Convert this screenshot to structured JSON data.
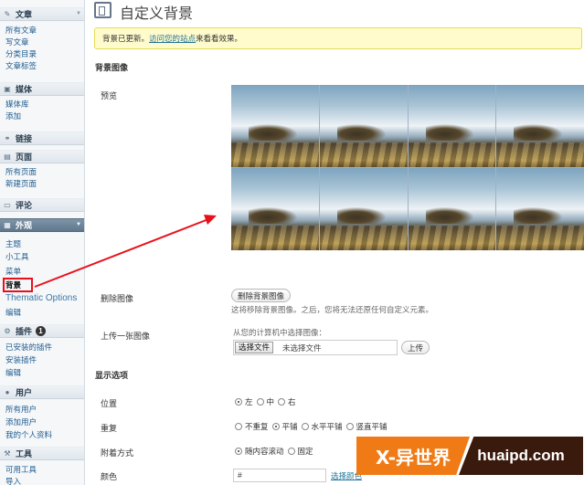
{
  "sidebar": {
    "articles": {
      "label": "文章",
      "items": [
        "所有文章",
        "写文章",
        "分类目录",
        "文章标签"
      ]
    },
    "media": {
      "label": "媒体",
      "items": [
        "媒体库",
        "添加"
      ]
    },
    "links": {
      "label": "链接"
    },
    "pages": {
      "label": "页面",
      "items": [
        "所有页面",
        "新建页面"
      ]
    },
    "comments": {
      "label": "评论"
    },
    "appearance": {
      "label": "外观",
      "items": [
        "主题",
        "小工具",
        "菜单",
        "背景",
        "Thematic Options",
        "编辑"
      ]
    },
    "plugins": {
      "label": "插件",
      "badge": "1",
      "items": [
        "已安装的插件",
        "安装插件",
        "编辑"
      ]
    },
    "users": {
      "label": "用户",
      "items": [
        "所有用户",
        "添加用户",
        "我的个人资料"
      ]
    },
    "tools": {
      "label": "工具",
      "items": [
        "可用工具",
        "导入"
      ]
    }
  },
  "main": {
    "title": "自定义背景",
    "notice": {
      "before": "背景已更新。",
      "link": "访问您的站点",
      "after": "来看看效果。"
    },
    "bg_image_section": "背景图像",
    "preview_label": "预览",
    "remove": {
      "label": "删除图像",
      "button": "删除背景图像",
      "hint": "这将移除背景图像。之后，您将无法还原任何自定义元素。"
    },
    "upload": {
      "label": "上传一张图像",
      "hint": "从您的计算机中选择图像：",
      "choose_button": "选择文件",
      "no_file": "未选择文件",
      "upload_button": "上传"
    },
    "display_section": "显示选项",
    "position": {
      "label": "位置",
      "options": [
        "左",
        "中",
        "右"
      ],
      "selected": 0
    },
    "repeat": {
      "label": "重复",
      "options": [
        "不重复",
        "平铺",
        "水平平铺",
        "竖直平铺"
      ],
      "selected": 1
    },
    "attachment": {
      "label": "附着方式",
      "options": [
        "随内容滚动",
        "固定"
      ],
      "selected": 0
    },
    "color": {
      "label": "颜色",
      "value": "#",
      "link": "选择颜色"
    }
  },
  "watermark": {
    "left": "X-异世界",
    "right": "huaipd.com"
  },
  "colors": {
    "highlight_box": "#e8111b",
    "notice_bg": "#fffbcc",
    "link": "#21759b",
    "watermark_orange": "#f07b16"
  }
}
